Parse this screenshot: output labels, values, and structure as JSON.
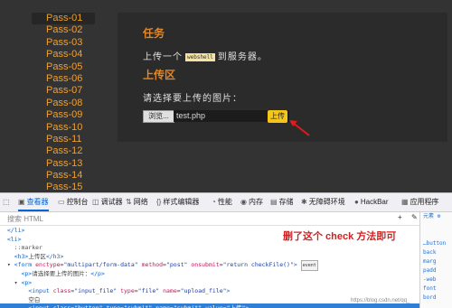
{
  "sidebar": {
    "items": [
      "Pass-01",
      "Pass-02",
      "Pass-03",
      "Pass-04",
      "Pass-05",
      "Pass-06",
      "Pass-07",
      "Pass-08",
      "Pass-09",
      "Pass-10",
      "Pass-11",
      "Pass-12",
      "Pass-13",
      "Pass-14",
      "Pass-15"
    ],
    "active": "Pass-01"
  },
  "card": {
    "task_heading": "任务",
    "task_prefix": "上传一个",
    "task_code": "webshell",
    "task_suffix": "到服务器。",
    "upload_heading": "上传区",
    "select_prompt": "请选择要上传的图片：",
    "browse_label": "浏览...",
    "file_value": "test.php",
    "upload_label": "上传"
  },
  "devtools": {
    "tabs": [
      {
        "icon": "inspector-icon",
        "glyph": "▣",
        "label": "查看器",
        "active": true
      },
      {
        "icon": "console-icon",
        "glyph": "▭",
        "label": "控制台"
      },
      {
        "icon": "debugger-icon",
        "glyph": "◫",
        "label": "调试器"
      },
      {
        "icon": "network-icon",
        "glyph": "⇅",
        "label": "网络"
      },
      {
        "icon": "style-editor-icon",
        "glyph": "{}",
        "label": "样式编辑器"
      },
      {
        "icon": "performance-icon",
        "glyph": "◔",
        "label": "性能"
      },
      {
        "icon": "memory-icon",
        "glyph": "◉",
        "label": "内存"
      },
      {
        "icon": "storage-icon",
        "glyph": "▤",
        "label": "存储"
      },
      {
        "icon": "accessibility-icon",
        "glyph": "✱",
        "label": "无障碍环境"
      },
      {
        "icon": "hackbar-icon",
        "glyph": "●",
        "label": "HackBar"
      },
      {
        "icon": "application-icon",
        "glyph": "▦",
        "label": "应用程序"
      }
    ],
    "search_placeholder": "搜索 HTML",
    "tree_lines": [
      {
        "indent": "  ",
        "parts": [
          [
            "tag",
            "</li>"
          ]
        ]
      },
      {
        "indent": "  ",
        "parts": [
          [
            "tag",
            "<li>"
          ]
        ]
      },
      {
        "indent": "    ",
        "parts": [
          [
            "cmt",
            "::marker"
          ]
        ]
      },
      {
        "indent": "    ",
        "parts": [
          [
            "tag",
            "<h3>"
          ],
          [
            "txt",
            "上传区"
          ],
          [
            "tag",
            "</h3>"
          ]
        ]
      },
      {
        "indent": "  ▾ ",
        "parts": [
          [
            "tag",
            "<form "
          ],
          [
            "an",
            "enctype"
          ],
          [
            "txt",
            "="
          ],
          [
            "av",
            "\"multipart/form-data\" "
          ],
          [
            "an",
            "method"
          ],
          [
            "txt",
            "="
          ],
          [
            "av",
            "\"post\" "
          ],
          [
            "an",
            "onsubmit"
          ],
          [
            "txt",
            "="
          ],
          [
            "av",
            "\"return checkFile()\""
          ],
          [
            "tag",
            ">"
          ]
        ],
        "event": "event"
      },
      {
        "indent": "      ",
        "parts": [
          [
            "tag",
            "<p>"
          ],
          [
            "txt",
            "请选择要上传的图片："
          ],
          [
            "tag",
            "</p>"
          ]
        ]
      },
      {
        "indent": "    ▾ ",
        "parts": [
          [
            "tag",
            "<p>"
          ]
        ]
      },
      {
        "indent": "        ",
        "parts": [
          [
            "tag",
            "<input "
          ],
          [
            "an",
            "class"
          ],
          [
            "txt",
            "="
          ],
          [
            "av",
            "\"input_file\" "
          ],
          [
            "an",
            "type"
          ],
          [
            "txt",
            "="
          ],
          [
            "av",
            "\"file\" "
          ],
          [
            "an",
            "name"
          ],
          [
            "txt",
            "="
          ],
          [
            "av",
            "\"upload_file\""
          ],
          [
            "tag",
            ">"
          ]
        ]
      },
      {
        "indent": "        ",
        "parts": [
          [
            "txt",
            "空白"
          ]
        ]
      },
      {
        "indent": "        ",
        "parts": [
          [
            "tag",
            "<input "
          ],
          [
            "an",
            "class"
          ],
          [
            "txt",
            "="
          ],
          [
            "av",
            "\"button\" "
          ],
          [
            "an",
            "type"
          ],
          [
            "txt",
            "="
          ],
          [
            "av",
            "\"submit\" "
          ],
          [
            "an",
            "name"
          ],
          [
            "txt",
            "="
          ],
          [
            "av",
            "\"submit\" "
          ],
          [
            "an",
            "value"
          ],
          [
            "txt",
            "="
          ],
          [
            "av",
            "\"上传\""
          ],
          [
            "tag",
            ">"
          ]
        ],
        "selected": true
      }
    ],
    "right_pane": [
      "元素 ⚙",
      "",
      "",
      "…button",
      "back",
      "marg",
      "padd",
      "-web",
      "font",
      "bord"
    ]
  },
  "annotation": "删了这个 check 方法即可",
  "watermark": "https://blog.csdn.net/qq_"
}
